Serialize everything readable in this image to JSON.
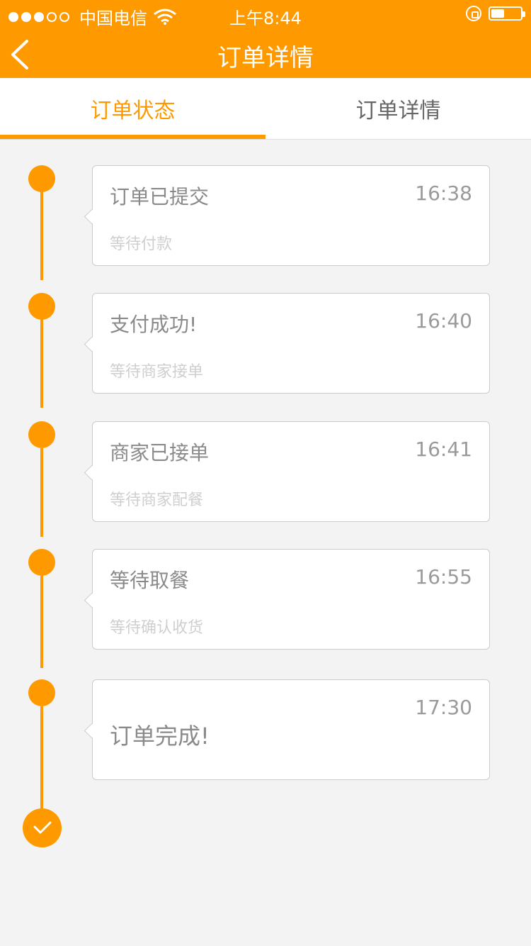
{
  "statusbar": {
    "carrier": "中国电信",
    "time": "上午8:44"
  },
  "navbar": {
    "title": "订单详情",
    "back_icon": "back-arrow-icon"
  },
  "tabs": [
    {
      "label": "订单状态"
    },
    {
      "label": "订单详情"
    }
  ],
  "timeline": [
    {
      "title": "订单已提交",
      "time": "16:38",
      "subtitle": "等待付款"
    },
    {
      "title": "支付成功!",
      "time": "16:40",
      "subtitle": "等待商家接单"
    },
    {
      "title": "商家已接单",
      "time": "16:41",
      "subtitle": "等待商家配餐"
    },
    {
      "title": "等待取餐",
      "time": "16:55",
      "subtitle": "等待确认收货"
    },
    {
      "title": "订单完成!",
      "time": "17:30",
      "subtitle": ""
    }
  ],
  "colors": {
    "accent": "#ff9900",
    "background": "#f3f3f3"
  }
}
